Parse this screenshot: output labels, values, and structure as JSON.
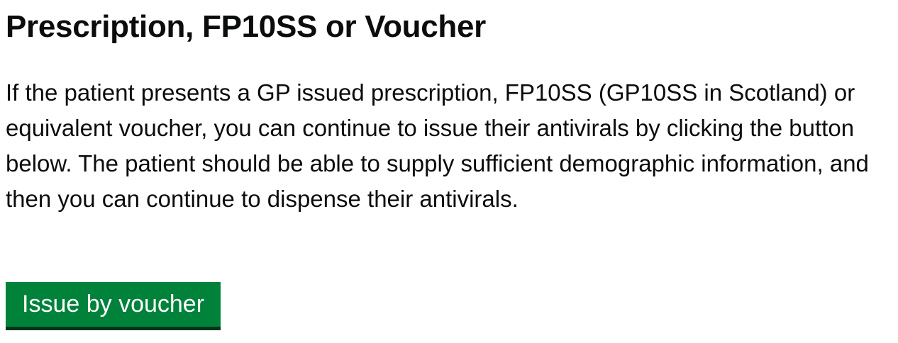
{
  "page": {
    "heading": "Prescription, FP10SS or Voucher",
    "body": "If the patient presents a GP issued prescription, FP10SS (GP10SS in Scotland) or equivalent voucher, you can continue to issue their antivirals by clicking the button below. The patient should be able to supply sufficient demographic information, and then you can continue to dispense their antivirals.",
    "button_label": "Issue by voucher"
  },
  "colors": {
    "text": "#0b0c0c",
    "button_background": "#00823b",
    "button_shadow": "#003618",
    "button_text": "#ffffff"
  }
}
